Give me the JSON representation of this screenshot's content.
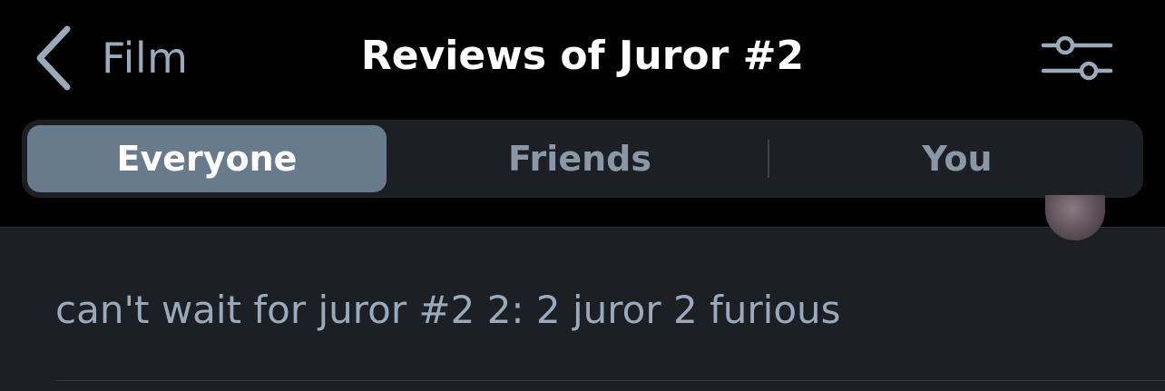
{
  "header": {
    "back_label": "Film",
    "title": "Reviews of Juror #2",
    "filter_icon": "sliders-icon"
  },
  "tabs": [
    {
      "label": "Everyone",
      "active": true
    },
    {
      "label": "Friends",
      "active": false
    },
    {
      "label": "You",
      "active": false
    }
  ],
  "review": {
    "text": "can't wait for juror #2 2: 2 juror 2 furious"
  },
  "colors": {
    "background": "#000000",
    "panel": "#1c2025",
    "active_tab": "#687b8d",
    "muted_text": "#99aabb",
    "title_text": "#ffffff"
  }
}
